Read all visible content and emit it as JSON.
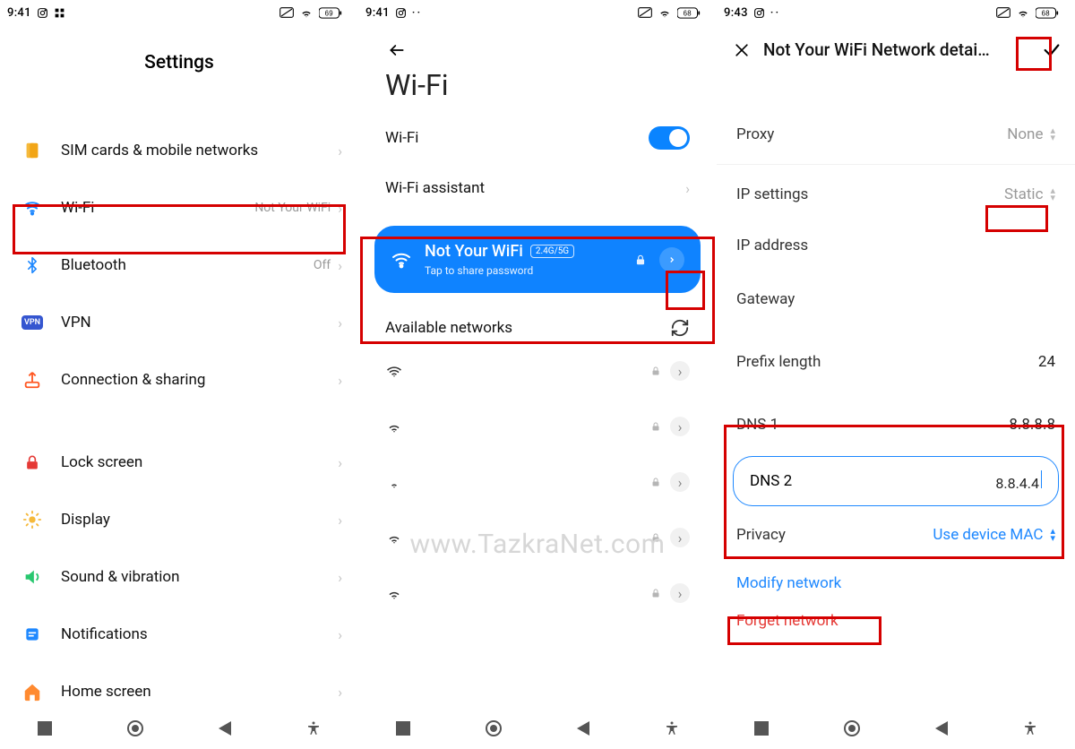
{
  "statusbar": {
    "time1": "9:41",
    "time2": "9:41",
    "time3": "9:43",
    "battery1": "69",
    "battery2": "68",
    "battery3": "68"
  },
  "watermark": {
    "url": "www.TazkraNet.com"
  },
  "col1": {
    "title": "Settings",
    "items": {
      "sim": {
        "label": "SIM cards & mobile networks"
      },
      "wifi": {
        "label": "Wi-Fi",
        "value": "Not Your WiFi"
      },
      "bluetooth": {
        "label": "Bluetooth",
        "value": "Off"
      },
      "vpn": {
        "label": "VPN",
        "badge": "VPN"
      },
      "connshare": {
        "label": "Connection & sharing"
      },
      "lock": {
        "label": "Lock screen"
      },
      "display": {
        "label": "Display"
      },
      "sound": {
        "label": "Sound & vibration"
      },
      "notif": {
        "label": "Notifications"
      },
      "home": {
        "label": "Home screen"
      }
    }
  },
  "col2": {
    "title": "Wi-Fi",
    "toggle_label": "Wi-Fi",
    "assistant_label": "Wi-Fi assistant",
    "connected": {
      "name": "Not Your WiFi",
      "band": "2.4G/5G",
      "sub": "Tap to share password"
    },
    "available_header": "Available networks"
  },
  "col3": {
    "title": "Not Your WiFi Network detai…",
    "proxy": {
      "label": "Proxy",
      "value": "None"
    },
    "ipset": {
      "label": "IP settings",
      "value": "Static"
    },
    "ipaddr": {
      "label": "IP address"
    },
    "gateway": {
      "label": "Gateway"
    },
    "prefix": {
      "label": "Prefix length",
      "value": "24"
    },
    "dns1": {
      "label": "DNS 1",
      "value": "8.8.8.8"
    },
    "dns2": {
      "label": "DNS 2",
      "value": "8.8.4.4"
    },
    "privacy": {
      "label": "Privacy",
      "value": "Use device MAC"
    },
    "modify": "Modify network",
    "forget": "Forget network"
  }
}
